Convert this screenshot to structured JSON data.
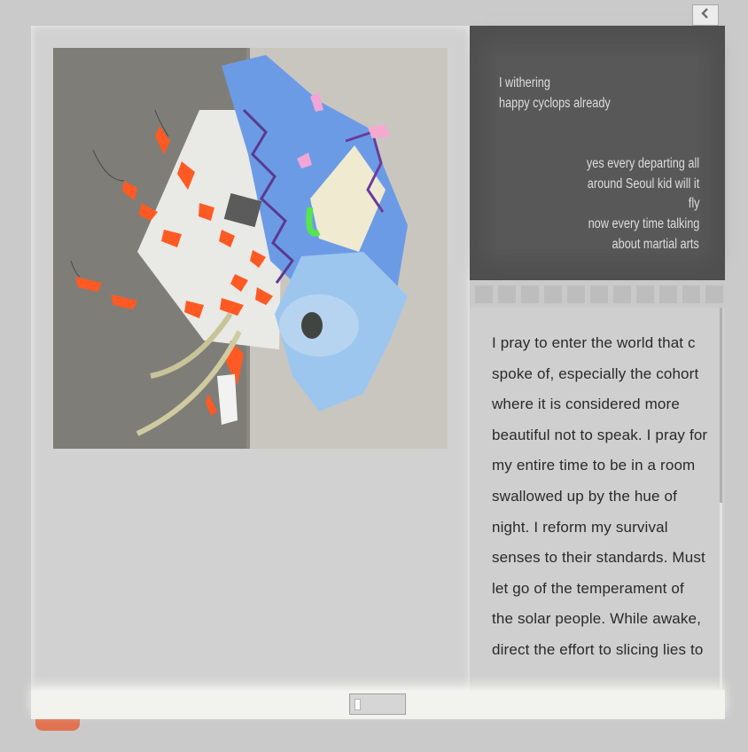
{
  "nav": {
    "back_icon": "chevron-left-icon"
  },
  "artwork": {
    "colors": {
      "wall_left": "#7f7d78",
      "wall_right": "#c9c6c0",
      "orange": "#ff5a23",
      "blue": "#6c9be6",
      "light_blue": "#9dc6ee"
    }
  },
  "poem": {
    "lines_left": [
      "I withering",
      "happy cyclops already"
    ],
    "lines_right": [
      "yes every departing all",
      "around Seoul kid will it",
      "fly",
      "now every time talking",
      "about martial arts"
    ]
  },
  "pager": {
    "count": 11
  },
  "essay": {
    "text": "I pray to enter the world that c spoke of, especially the cohort where it is considered more beautiful not to speak. I pray for my entire time to be in a room swallowed up by the hue of night. I reform my survival senses to their standards. Must let go of the temperament of the solar people. While awake, direct the effort to slicing lies to"
  },
  "slider": {
    "position": 0.05
  },
  "colors": {
    "accent": "#e0724f",
    "poem_bg": "#4f4f4f",
    "page_bg": "#cacaca"
  }
}
